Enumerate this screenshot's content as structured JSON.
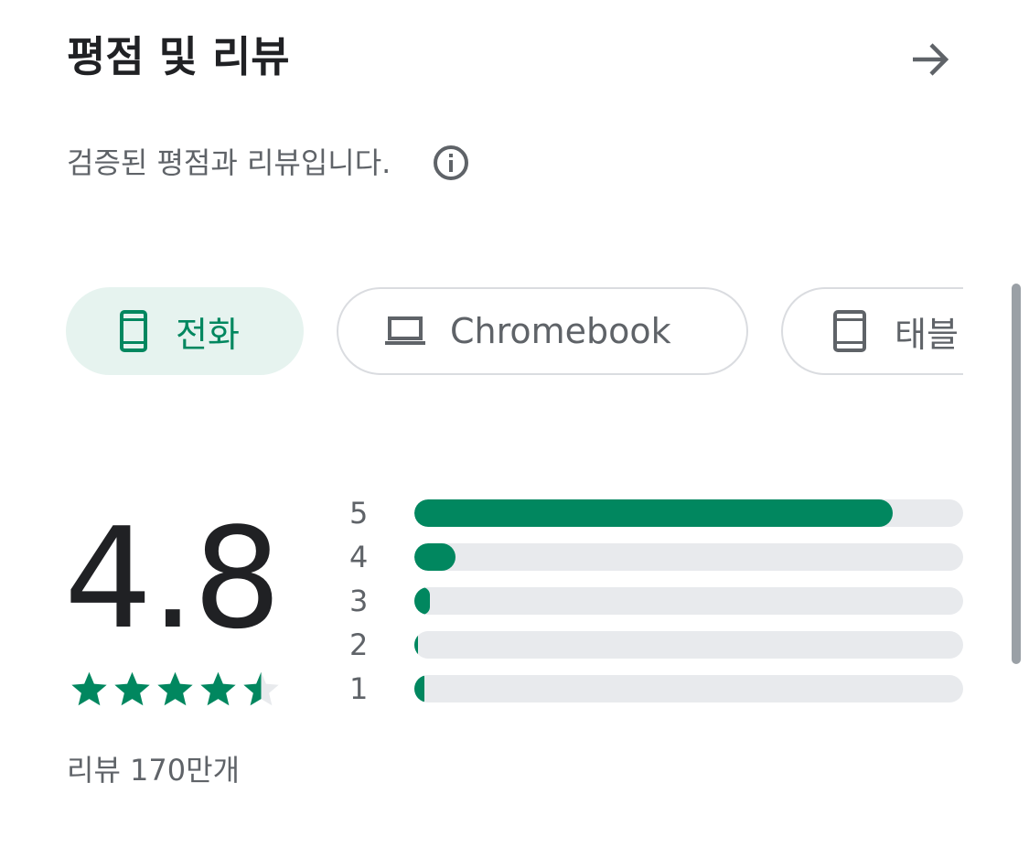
{
  "header": {
    "title": "평점 및 리뷰",
    "arrow_icon": "arrow-forward-icon"
  },
  "subtitle": {
    "text": "검증된 평점과 리뷰입니다.",
    "info_icon": "info-icon"
  },
  "device_chips": [
    {
      "label": "전화",
      "icon": "phone-icon",
      "selected": true
    },
    {
      "label": "Chromebook",
      "icon": "laptop-icon",
      "selected": false
    },
    {
      "label": "태블",
      "icon": "tablet-icon",
      "selected": false
    }
  ],
  "rating": {
    "value": "4.8",
    "stars": 4.8,
    "review_count": "리뷰 170만개"
  },
  "histogram": [
    {
      "label": "5",
      "fraction": 0.872
    },
    {
      "label": "4",
      "fraction": 0.075
    },
    {
      "label": "3",
      "fraction": 0.028
    },
    {
      "label": "2",
      "fraction": 0.006
    },
    {
      "label": "1",
      "fraction": 0.018
    }
  ],
  "colors": {
    "accent": "#01875f",
    "chip_selected_bg": "#e6f3ef",
    "track": "#e8eaed",
    "text_primary": "#202124",
    "text_secondary": "#5f6368"
  }
}
